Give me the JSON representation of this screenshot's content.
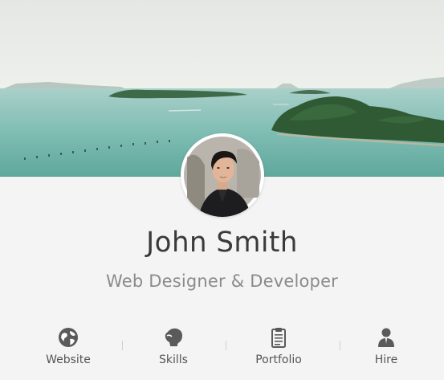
{
  "profile": {
    "name": "John Smith",
    "title": "Web Designer & Developer"
  },
  "header": {
    "share_icon": "share-icon"
  },
  "nav": {
    "items": [
      {
        "label": "Website",
        "icon": "globe-icon"
      },
      {
        "label": "Skills",
        "icon": "boxing-glove-icon"
      },
      {
        "label": "Portfolio",
        "icon": "clipboard-icon"
      },
      {
        "label": "Hire",
        "icon": "person-icon"
      }
    ]
  },
  "colors": {
    "background": "#f4f4f4",
    "name": "#3a3a3a",
    "title": "#8b8b8b",
    "nav_label": "#555555",
    "icon": "#5a5a5a",
    "sea": "#8cc5bd",
    "sky": "#e9ece8"
  }
}
